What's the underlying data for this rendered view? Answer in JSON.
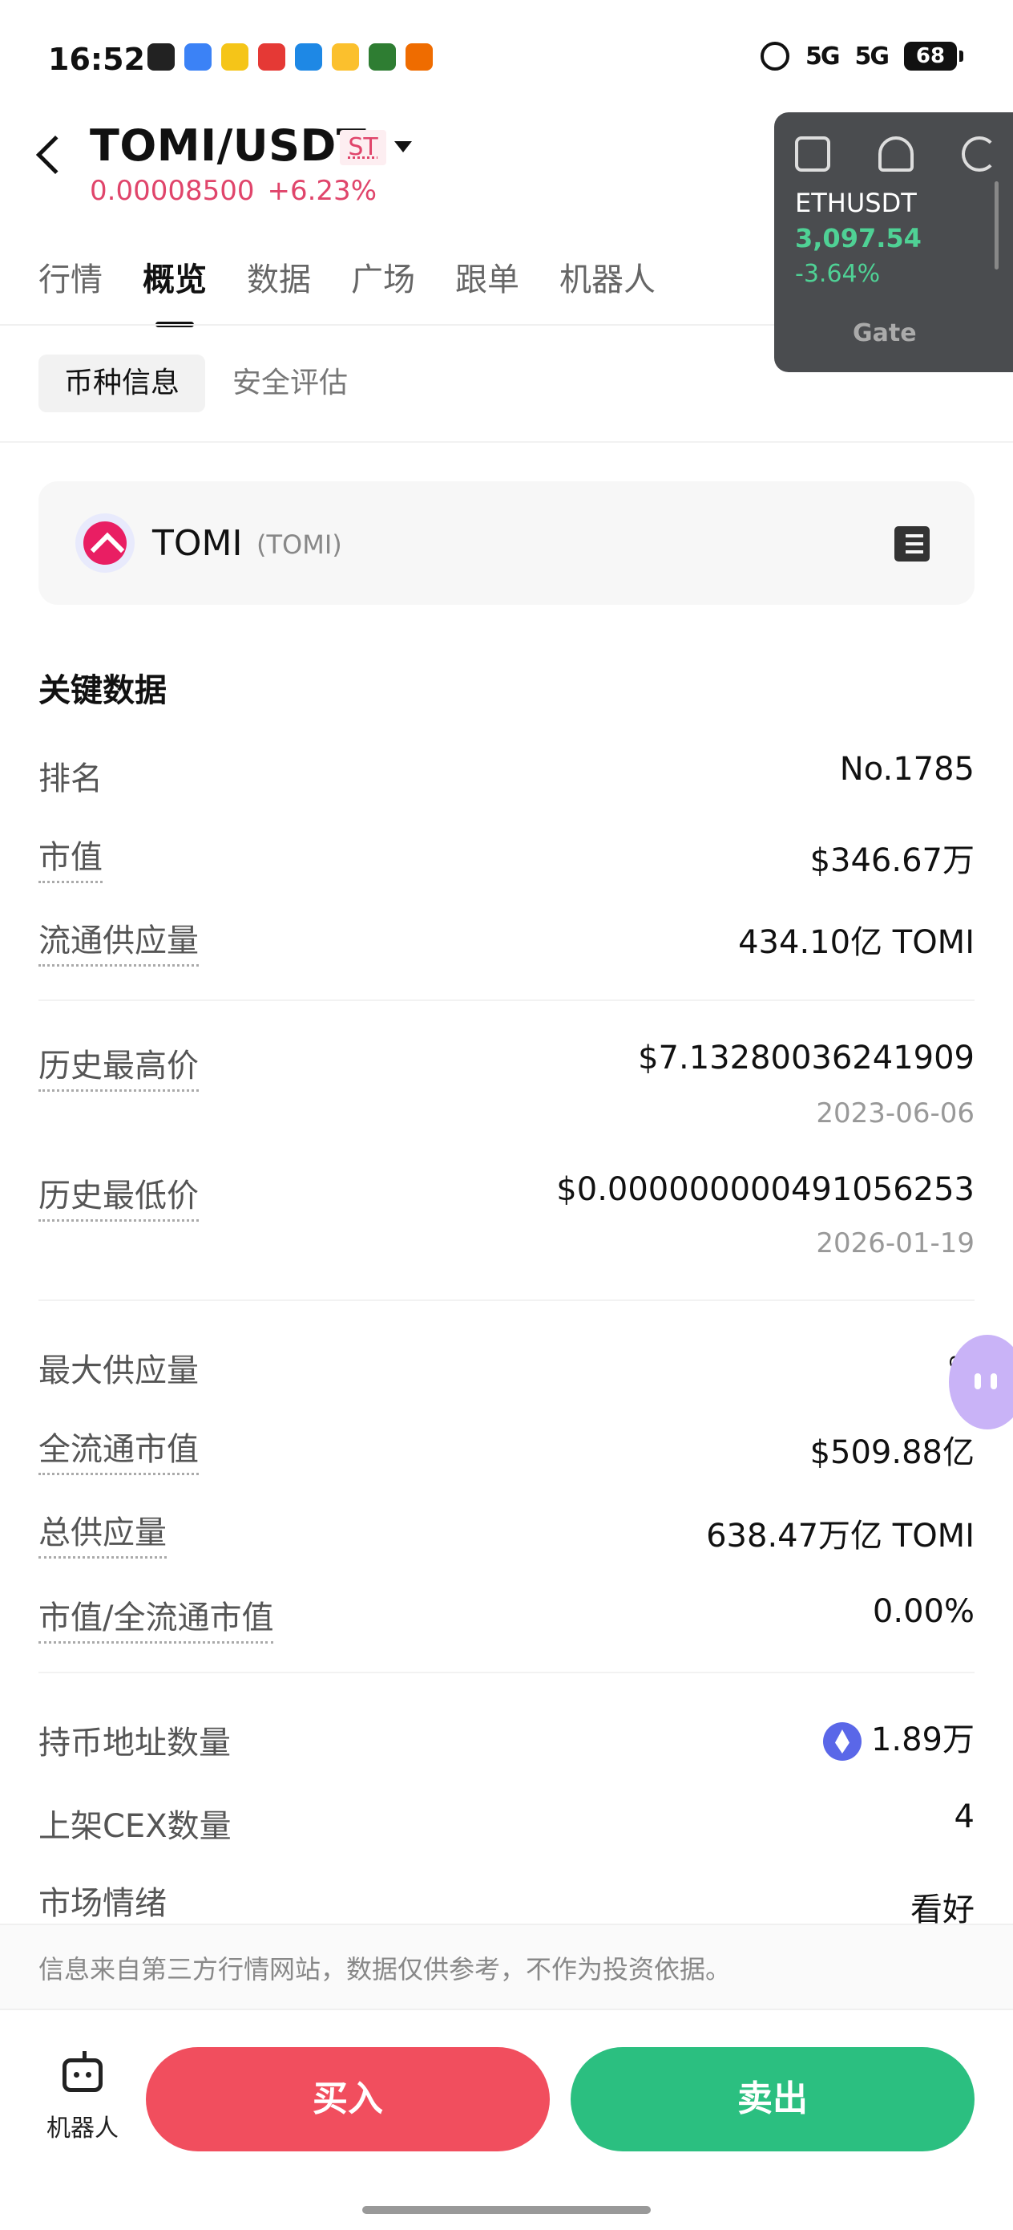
{
  "status_bar": {
    "time": "16:52",
    "signal1": "5G",
    "signal2": "5G",
    "battery": "68"
  },
  "header": {
    "pair": "TOMI/USDT",
    "badge": "ST",
    "price": "0.00008500",
    "change": "+6.23%",
    "price_color": "#e0456b"
  },
  "tabs": [
    {
      "label": "行情"
    },
    {
      "label": "概览",
      "active": true
    },
    {
      "label": "数据"
    },
    {
      "label": "广场"
    },
    {
      "label": "跟单"
    },
    {
      "label": "机器人"
    }
  ],
  "subtabs": {
    "active": "币种信息",
    "inactive": "安全评估"
  },
  "coin": {
    "name": "TOMI",
    "symbol": "(TOMI)"
  },
  "key_data": {
    "title": "关键数据",
    "rank_label": "排名",
    "rank_value": "No.1785",
    "mcap_label": "市值",
    "mcap_value": "$346.67万",
    "circ_label": "流通供应量",
    "circ_value": "434.10亿 TOMI",
    "ath_label": "历史最高价",
    "ath_value": "$7.13280036241909",
    "ath_date": "2023-06-06",
    "atl_label": "历史最低价",
    "atl_value": "$0.000000000491056253",
    "atl_date": "2026-01-19",
    "max_label": "最大供应量",
    "max_value": "∞",
    "fdv_label": "全流通市值",
    "fdv_value": "$509.88亿",
    "total_label": "总供应量",
    "total_value": "638.47万亿 TOMI",
    "ratio_label": "市值/全流通市值",
    "ratio_value": "0.00%",
    "holders_label": "持币地址数量",
    "holders_value": "1.89万",
    "cex_label": "上架CEX数量",
    "cex_value": "4",
    "sentiment_label": "市场情绪",
    "sentiment_value": "看好"
  },
  "footer": {
    "disclaimer": "信息来自第三方行情网站，数据仅供参考，不作为投资依据。",
    "robot_label": "机器人",
    "buy_label": "买入",
    "sell_label": "卖出",
    "buy_color": "#f14e5e",
    "sell_color": "#2bbf80"
  },
  "widget": {
    "pair": "ETHUSDT",
    "price": "3,097.54",
    "change": "-3.64%",
    "brand": "Gate"
  }
}
